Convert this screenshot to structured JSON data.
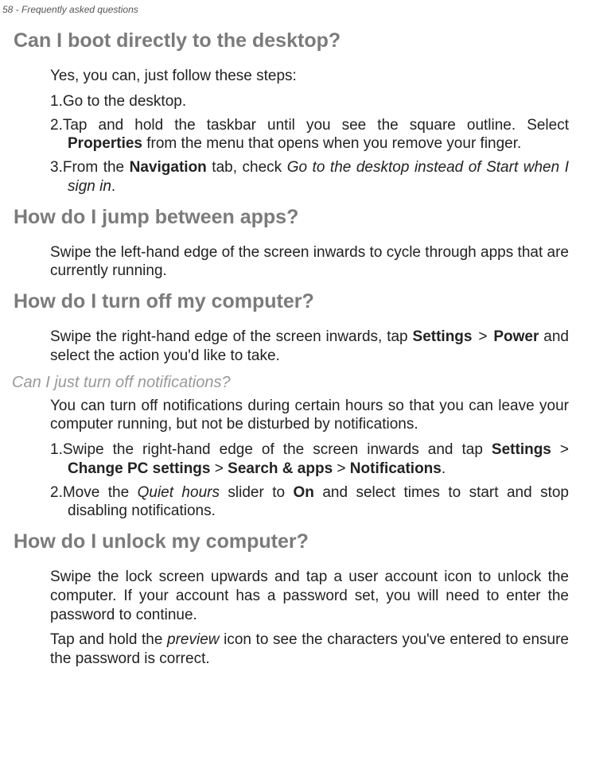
{
  "header": {
    "pageinfo": "58 - Frequently asked questions"
  },
  "sec1": {
    "title": "Can I boot directly to the desktop?",
    "intro": "Yes, you can, just follow these steps:",
    "i1_num": "1.",
    "i1_text": "Go to the desktop.",
    "i2_num": "2.",
    "i2_a": "Tap and hold the taskbar until you see the square outline. Select ",
    "i2_b": "Properties",
    "i2_c": " from the menu that opens when you remove your finger.",
    "i3_num": "3.",
    "i3_a": "From the ",
    "i3_b": "Navigation",
    "i3_c": " tab, check ",
    "i3_d": "Go to the desktop instead of Start when I sign in",
    "i3_e": "."
  },
  "sec2": {
    "title": "How do I jump between apps?",
    "p": "Swipe the left-hand edge of the screen inwards to cycle through apps that are currently running."
  },
  "sec3": {
    "title": "How do I turn off my computer?",
    "p_a": "Swipe the right-hand edge of the screen inwards, tap ",
    "p_b": "Settings",
    "p_c": " > ",
    "p_d": "Power",
    "p_e": " and select the action you'd like to take."
  },
  "sec4": {
    "title": "Can I just turn off notifications?",
    "p": "You can turn off notifications during certain hours so that you can leave your computer running, but not be disturbed by notifications.",
    "i1_num": "1.",
    "i1_a": "Swipe the right-hand edge of the screen inwards and tap ",
    "i1_b": "Settings",
    "i1_c": " > ",
    "i1_d": "Change PC settings",
    "i1_e": " > ",
    "i1_f": "Search & apps",
    "i1_g": " > ",
    "i1_h": "Notifications",
    "i1_i": ".",
    "i2_num": "2.",
    "i2_a": "Move the ",
    "i2_b": "Quiet hours",
    "i2_c": " slider to ",
    "i2_d": "On",
    "i2_e": " and select times to start and stop disabling notifications."
  },
  "sec5": {
    "title": "How do I unlock my computer?",
    "p1": "Swipe the lock screen upwards and tap a user account icon to unlock the computer. If your account has a password set, you will need to enter the password to continue.",
    "p2_a": "Tap and hold the ",
    "p2_b": "preview",
    "p2_c": " icon to see the characters you've entered to ensure the password is correct."
  }
}
